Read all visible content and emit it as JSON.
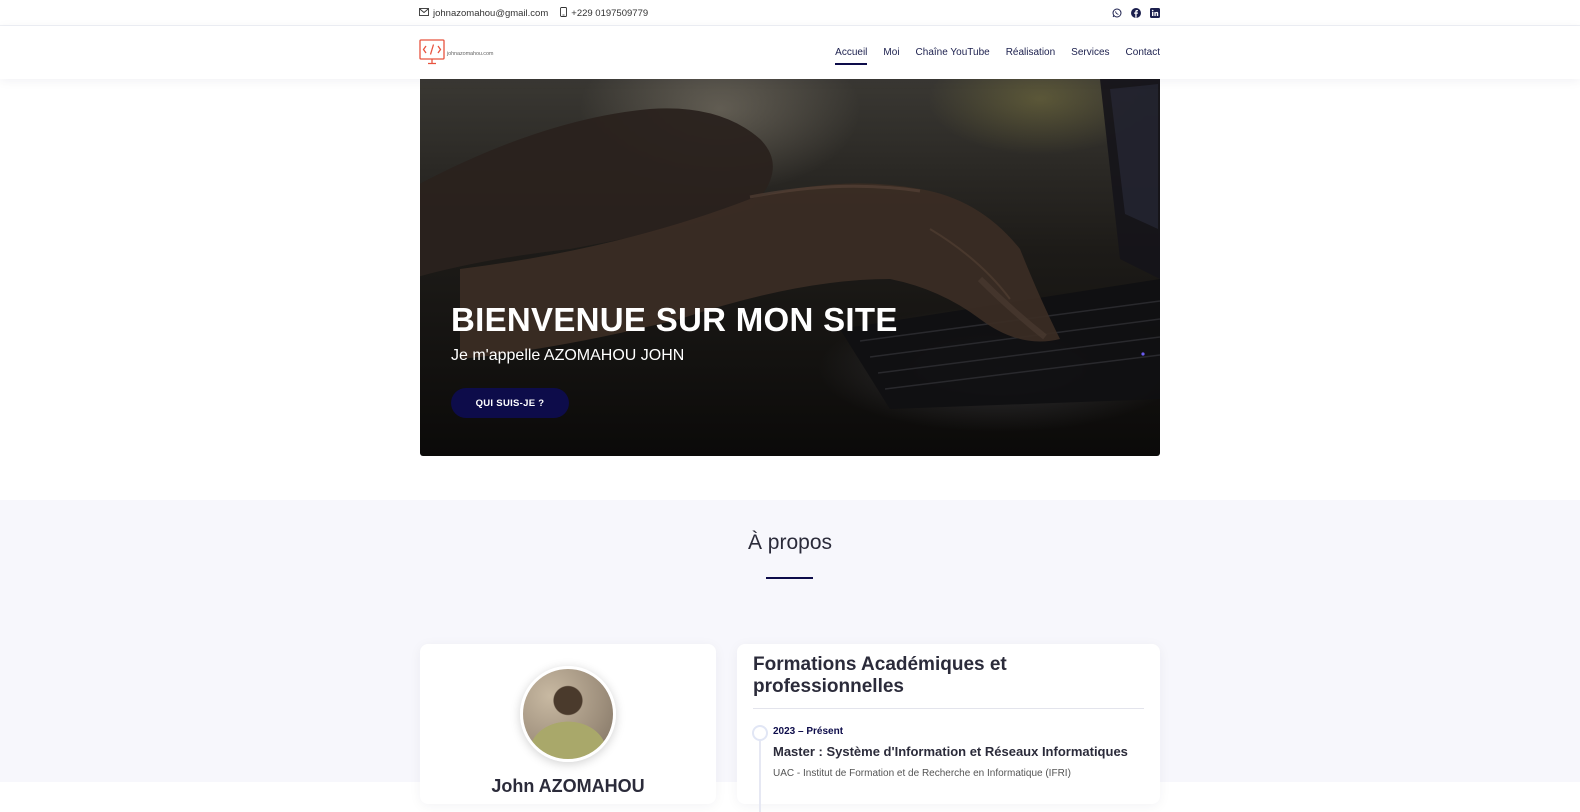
{
  "topbar": {
    "email": "johnazomahou@gmail.com",
    "phone": "+229 0197509779",
    "email_icon": "mail-icon",
    "phone_icon": "phone-icon",
    "social": [
      "whatsapp-icon",
      "facebook-icon",
      "linkedin-icon"
    ]
  },
  "header": {
    "logo_text": "johnazomahou.com",
    "logo_symbol": "</>",
    "nav": [
      {
        "label": "Accueil",
        "active": true
      },
      {
        "label": "Moi"
      },
      {
        "label": "Chaîne YouTube"
      },
      {
        "label": "Réalisation"
      },
      {
        "label": "Services"
      },
      {
        "label": "Contact"
      }
    ]
  },
  "hero": {
    "title": "BIENVENUE SUR MON SITE",
    "subtitle": "Je m'appelle AZOMAHOU JOHN",
    "button_label": "QUI SUIS-JE ?"
  },
  "about": {
    "title": "À propos",
    "profile_name": "John AZOMAHOU",
    "formations": {
      "title": "Formations Académiques et professionnelles",
      "items": [
        {
          "date": "2023 – Présent",
          "degree": "Master : Système d'Information et Réseaux Informatiques",
          "school": "UAC - Institut de Formation et de Recherche en Informatique (IFRI)"
        }
      ]
    }
  },
  "colors": {
    "accent": "#0d0c4a",
    "logo": "#e8533f",
    "section_bg": "#f7f7fc"
  }
}
